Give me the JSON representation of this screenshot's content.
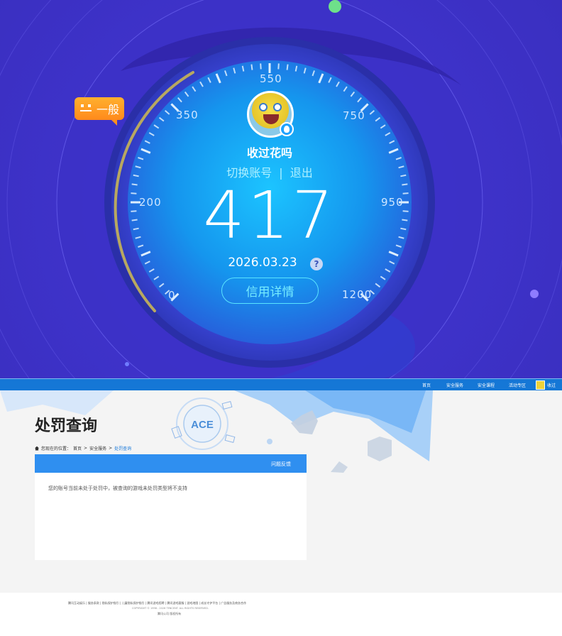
{
  "credit": {
    "level_text": "一般",
    "username": "收过花吗",
    "switch_account": "切换账号",
    "separator": "|",
    "logout": "退出",
    "score": "417",
    "date": "2026.03.23",
    "help": "?",
    "detail_button": "信用详情",
    "gauge_labels": [
      "0",
      "200",
      "350",
      "550",
      "750",
      "950",
      "1200"
    ],
    "score_min": 0,
    "score_max": 1200
  },
  "nav": {
    "items": [
      "首页",
      "安全服务",
      "安全课程",
      "活动专区"
    ],
    "user": "收过"
  },
  "penalty": {
    "title": "处罚查询",
    "breadcrumb": [
      "您现在的位置：",
      "首页",
      "安全服务",
      "处罚查询"
    ],
    "breadcrumb_sep": ">",
    "feedback": "问题反馈",
    "message": "您的账号当前未处于处罚中，被查询的游戏未处罚类型将不支持"
  },
  "footer": {
    "links": "腾讯互动娱乐 | 服务条款 | 隐私保护指引 | 儿童隐私保护指引 | 腾讯游戏招聘 | 腾讯游戏客服 | 游戏地图 | 成长守护平台 | 广告服务及商务合作",
    "copyright": "COPYRIGHT © 1998 - 2026 TENCENT. ALL RIGHTS RESERVED.",
    "rights": "腾讯公司 版权所有"
  },
  "colors": {
    "top_bg": "#3f33cc",
    "gauge_inner": "#1aa8f5",
    "badge_orange": "#ff9a22",
    "nav_blue": "#1577d6",
    "panel_blue": "#2f8ff0"
  }
}
